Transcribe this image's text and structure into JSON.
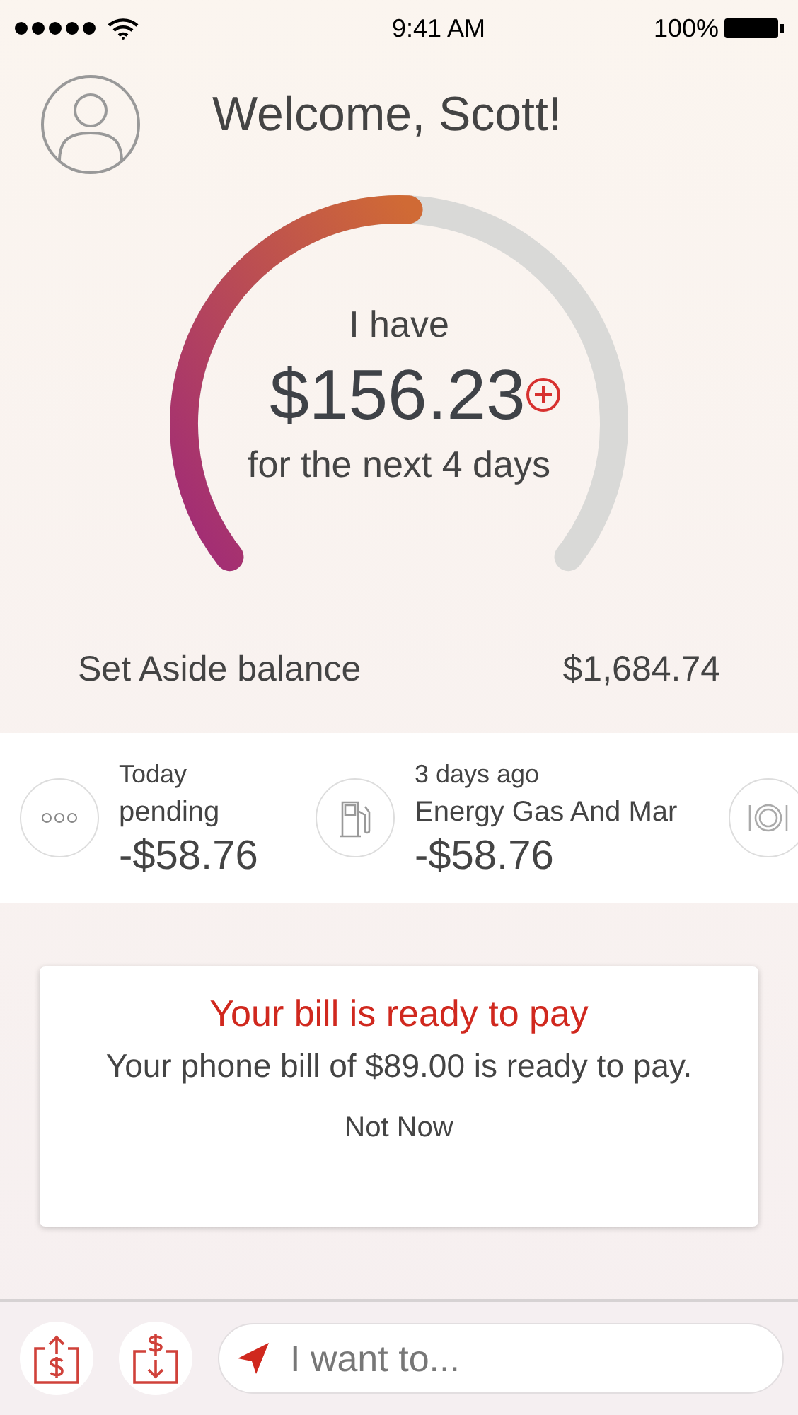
{
  "status_bar": {
    "time": "9:41 AM",
    "battery": "100%"
  },
  "header": {
    "greeting": "Welcome, Scott!"
  },
  "gauge": {
    "caption_top": "I have",
    "amount": "$156.23",
    "caption_bottom": "for the next 4 days"
  },
  "set_aside": {
    "label": "Set Aside balance",
    "value": "$1,684.74"
  },
  "transactions": [
    {
      "kind": "pending",
      "date": "Today",
      "name": "pending",
      "amount": "-$58.76"
    },
    {
      "kind": "gas",
      "date": "3 days ago",
      "name": "Energy Gas And Mar",
      "amount": "-$58.76"
    },
    {
      "kind": "dining"
    }
  ],
  "bill_card": {
    "title": "Your bill is ready to pay",
    "message": "Your phone bill of $89.00 is ready to pay.",
    "action": "Not Now"
  },
  "bottom_bar": {
    "placeholder": "I want to..."
  }
}
